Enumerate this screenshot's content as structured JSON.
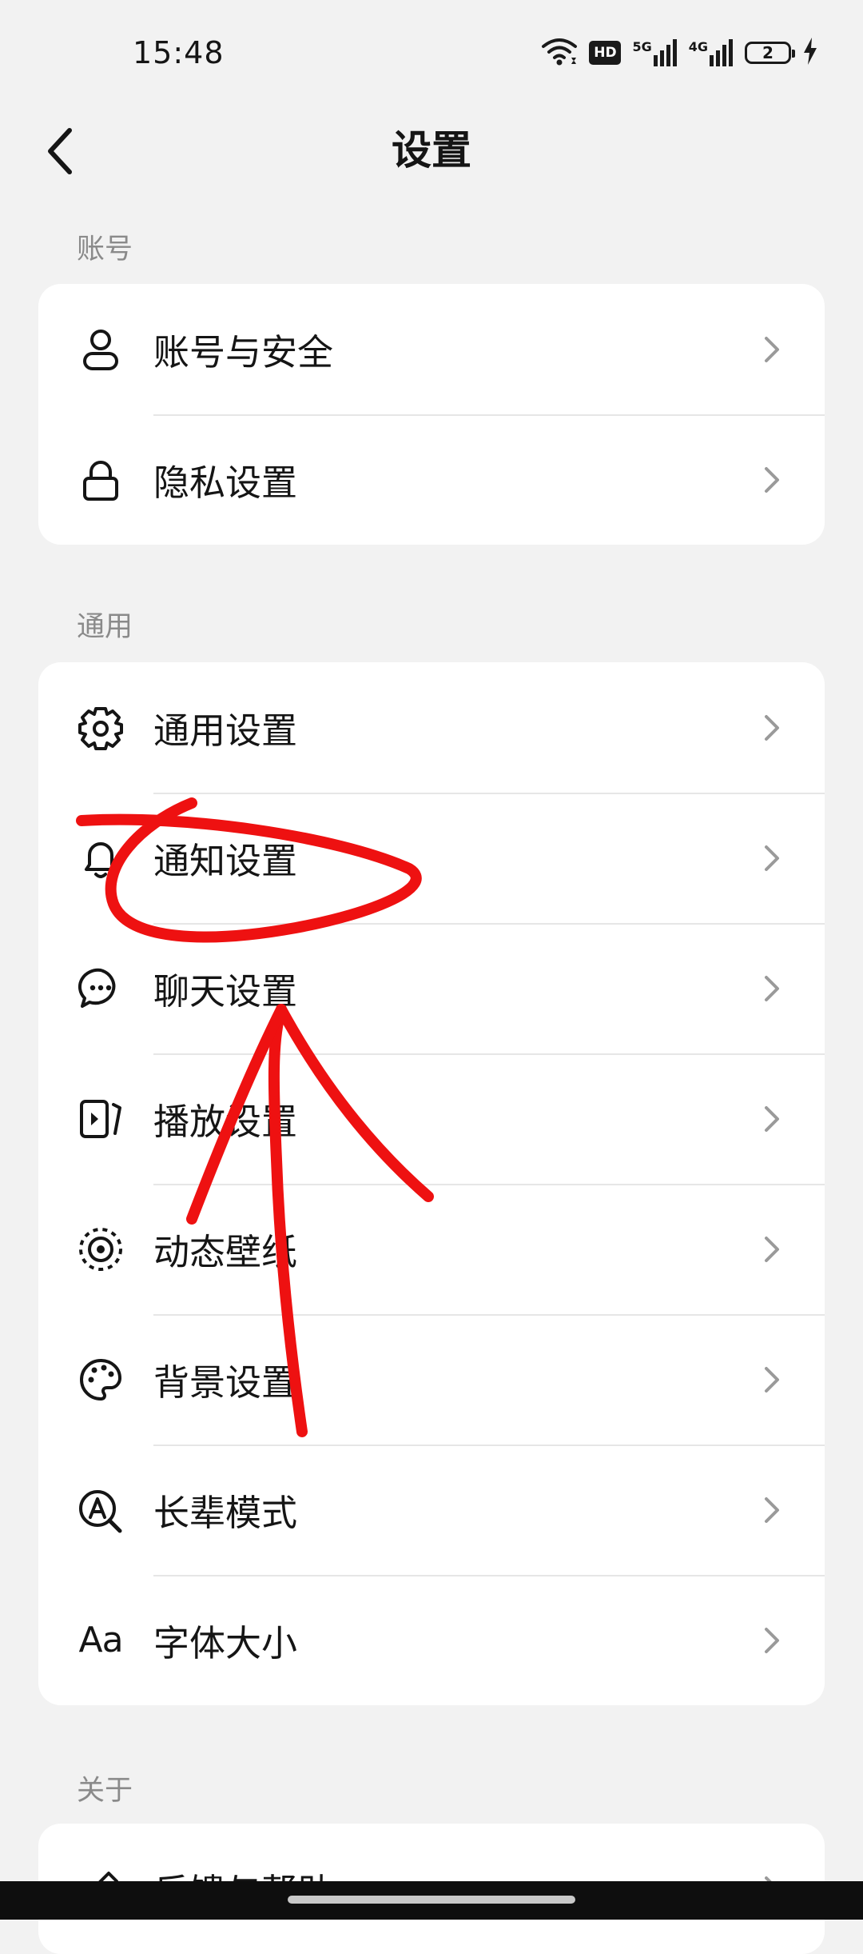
{
  "status_bar": {
    "time": "15:48",
    "hd_label": "HD",
    "net1": "5G",
    "net2": "4G",
    "battery": "2",
    "icons": [
      "wifi-icon",
      "hd-call-icon",
      "signal-5g-icon",
      "signal-4g-icon",
      "battery-icon",
      "charging-icon"
    ]
  },
  "header": {
    "title": "设置",
    "back_icon": "chevron-left-icon"
  },
  "sections": {
    "account": {
      "label": "账号",
      "items": [
        {
          "label": "账号与安全",
          "icon": "user-icon"
        },
        {
          "label": "隐私设置",
          "icon": "lock-icon"
        }
      ]
    },
    "general": {
      "label": "通用",
      "items": [
        {
          "label": "通用设置",
          "icon": "gear-icon"
        },
        {
          "label": "通知设置",
          "icon": "bell-icon"
        },
        {
          "label": "聊天设置",
          "icon": "chat-bubble-icon"
        },
        {
          "label": "播放设置",
          "icon": "play-screen-icon"
        },
        {
          "label": "动态壁纸",
          "icon": "live-wallpaper-icon"
        },
        {
          "label": "背景设置",
          "icon": "palette-icon"
        },
        {
          "label": "长辈模式",
          "icon": "elder-mode-icon"
        },
        {
          "label": "字体大小",
          "icon": "font-size-icon",
          "glyph": "Aa"
        }
      ]
    },
    "about": {
      "label": "关于",
      "items": [
        {
          "label": "反馈与帮助",
          "icon": "feedback-icon"
        }
      ]
    }
  },
  "annotation": {
    "color": "#ee1111",
    "shapes": [
      "circle-stroke",
      "arrow-stroke"
    ]
  },
  "colors": {
    "background": "#f2f2f2",
    "card": "#ffffff",
    "text": "#151515",
    "section_label": "#8a8a8a",
    "chevron": "#9a9a9a"
  }
}
